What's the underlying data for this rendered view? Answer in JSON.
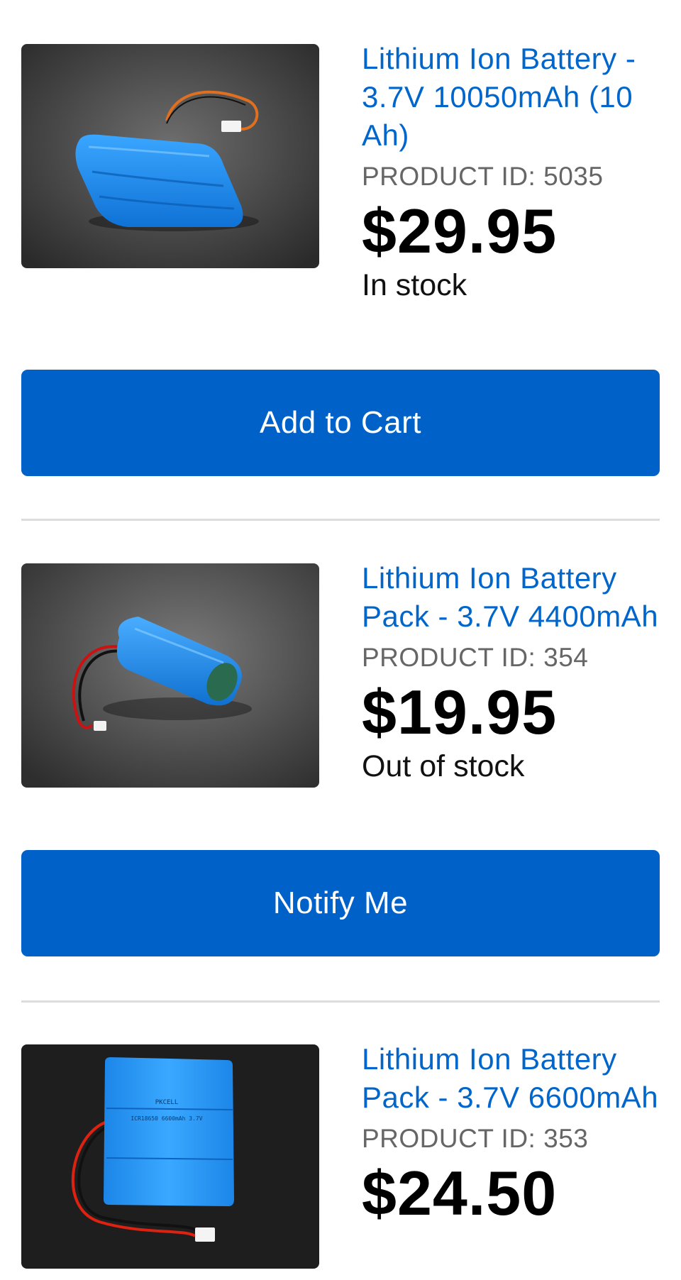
{
  "products": [
    {
      "title": "Lithium Ion Battery - 3.7V 10050mAh (10 Ah)",
      "product_id": "PRODUCT ID: 5035",
      "price": "$29.95",
      "stock": "In stock",
      "button": "Add to Cart"
    },
    {
      "title": "Lithium Ion Battery Pack - 3.7V 4400mAh",
      "product_id": "PRODUCT ID: 354",
      "price": "$19.95",
      "stock": "Out of stock",
      "button": "Notify Me"
    },
    {
      "title": "Lithium Ion Battery Pack - 3.7V 6600mAh",
      "product_id": "PRODUCT ID: 353",
      "price": "$24.50"
    }
  ],
  "image_labels": {
    "cell_brand": "PKCELL",
    "cell_model": "ICR18650 6600mAh 3.7V"
  },
  "colors": {
    "link": "#0066cc",
    "button": "#0062c9",
    "battery": "#1e8ff0"
  }
}
